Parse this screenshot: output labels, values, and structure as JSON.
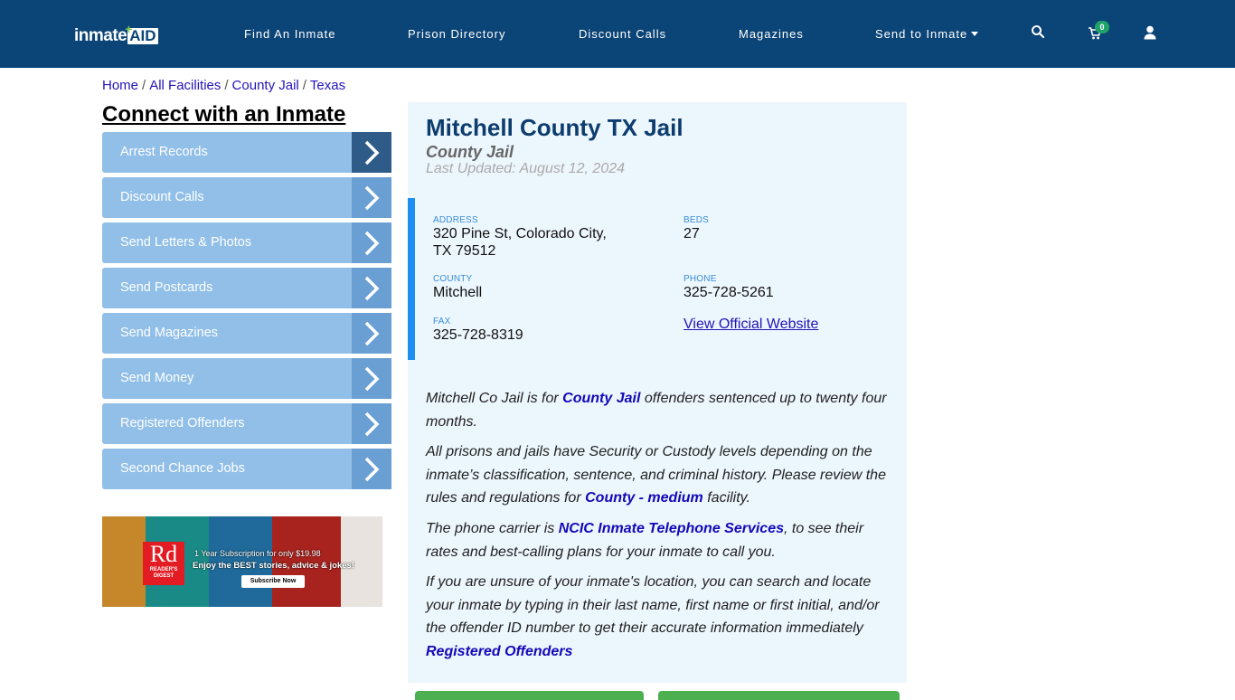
{
  "header": {
    "logo": {
      "part1": "inmate",
      "part2": "AID",
      "plus": "+"
    },
    "nav": [
      {
        "label": "Find An Inmate"
      },
      {
        "label": "Prison Directory"
      },
      {
        "label": "Discount Calls"
      },
      {
        "label": "Magazines"
      },
      {
        "label": "Send to Inmate",
        "dropdown": true
      }
    ],
    "icons": {
      "search": "search-icon",
      "cart": "cart-icon",
      "user": "user-icon"
    },
    "cart_count": "0"
  },
  "breadcrumb": [
    {
      "label": "Home"
    },
    {
      "label": "All Facilities"
    },
    {
      "label": "County Jail"
    },
    {
      "label": "Texas"
    }
  ],
  "breadcrumb_sep": "/",
  "sidebar": {
    "title": "Connect with an Inmate",
    "items": [
      {
        "label": "Arrest Records"
      },
      {
        "label": "Discount Calls"
      },
      {
        "label": "Send Letters & Photos"
      },
      {
        "label": "Send Postcards"
      },
      {
        "label": "Send Magazines"
      },
      {
        "label": "Send Money"
      },
      {
        "label": "Registered Offenders"
      },
      {
        "label": "Second Chance Jobs"
      }
    ],
    "ad": {
      "brand_short": "Rd",
      "brand_line1": "READER'S",
      "brand_line2": "DIGEST",
      "line1": "1 Year Subscription for only $19.98",
      "line2": "Enjoy the BEST stories, advice & jokes!",
      "cta": "Subscribe Now"
    }
  },
  "facility": {
    "name": "Mitchell County TX Jail",
    "type": "County Jail",
    "last_updated": "Last Updated: August 12, 2024",
    "address_label": "Address",
    "address_line1": "320 Pine St, Colorado City,",
    "address_line2": "TX 79512",
    "beds_label": "Beds",
    "beds": "27",
    "county_label": "County",
    "county": "Mitchell",
    "phone_label": "Phone",
    "phone": "325-728-5261",
    "fax_label": "Fax",
    "fax": "325-728-8319",
    "website_link": "View Official Website"
  },
  "description": {
    "p1_a": "Mitchell Co Jail is for ",
    "p1_link": "County Jail",
    "p1_b": " offenders sentenced up to twenty four months.",
    "p2_a": "All prisons and jails have Security or Custody levels depending on the inmate’s classification, sentence, and criminal history. Please review the rules and regulations for ",
    "p2_link": "County - medium",
    "p2_b": " facility.",
    "p3_a": "The phone carrier is ",
    "p3_link": "NCIC Inmate Telephone Services",
    "p3_b": ", to see their rates and best-calling plans for your inmate to call you.",
    "p4_a": "If you are unsure of your inmate's location, you can search and locate your inmate by typing in their last name, first name or first initial, and/or the offender ID number to get their accurate information immediately",
    "p4_link": "Registered Offenders"
  },
  "colors": {
    "navbar": "#0b4476",
    "sidebar_item": "#91bfe8",
    "sidebar_arrow": "#6a9fd4",
    "sidebar_arrow_active": "#2e5b88",
    "card_bg": "#ecf6fd",
    "accent_bar": "#1e8ff0",
    "green_button": "#4caf50"
  }
}
